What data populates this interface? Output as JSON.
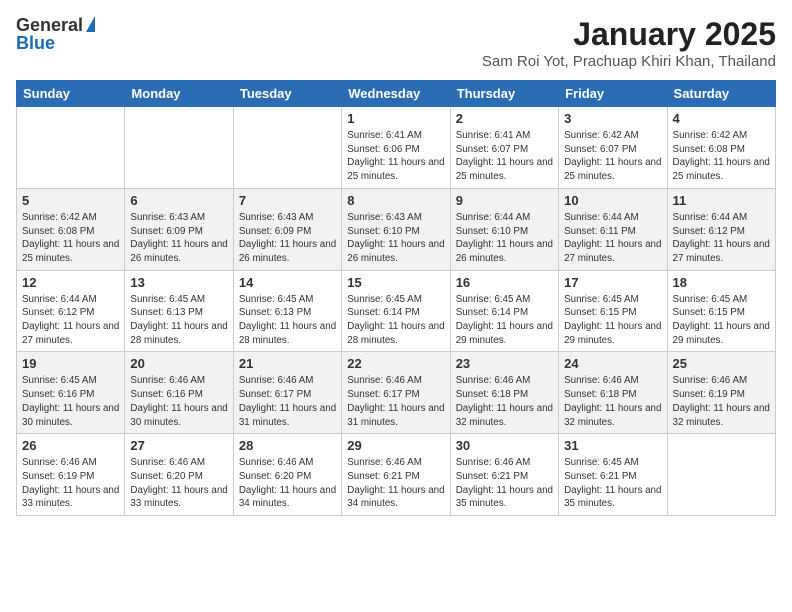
{
  "logo": {
    "general": "General",
    "blue": "Blue"
  },
  "title": "January 2025",
  "subtitle": "Sam Roi Yot, Prachuap Khiri Khan, Thailand",
  "days_of_week": [
    "Sunday",
    "Monday",
    "Tuesday",
    "Wednesday",
    "Thursday",
    "Friday",
    "Saturday"
  ],
  "weeks": [
    [
      {
        "day": "",
        "sunrise": "",
        "sunset": "",
        "daylight": ""
      },
      {
        "day": "",
        "sunrise": "",
        "sunset": "",
        "daylight": ""
      },
      {
        "day": "",
        "sunrise": "",
        "sunset": "",
        "daylight": ""
      },
      {
        "day": "1",
        "sunrise": "Sunrise: 6:41 AM",
        "sunset": "Sunset: 6:06 PM",
        "daylight": "Daylight: 11 hours and 25 minutes."
      },
      {
        "day": "2",
        "sunrise": "Sunrise: 6:41 AM",
        "sunset": "Sunset: 6:07 PM",
        "daylight": "Daylight: 11 hours and 25 minutes."
      },
      {
        "day": "3",
        "sunrise": "Sunrise: 6:42 AM",
        "sunset": "Sunset: 6:07 PM",
        "daylight": "Daylight: 11 hours and 25 minutes."
      },
      {
        "day": "4",
        "sunrise": "Sunrise: 6:42 AM",
        "sunset": "Sunset: 6:08 PM",
        "daylight": "Daylight: 11 hours and 25 minutes."
      }
    ],
    [
      {
        "day": "5",
        "sunrise": "Sunrise: 6:42 AM",
        "sunset": "Sunset: 6:08 PM",
        "daylight": "Daylight: 11 hours and 25 minutes."
      },
      {
        "day": "6",
        "sunrise": "Sunrise: 6:43 AM",
        "sunset": "Sunset: 6:09 PM",
        "daylight": "Daylight: 11 hours and 26 minutes."
      },
      {
        "day": "7",
        "sunrise": "Sunrise: 6:43 AM",
        "sunset": "Sunset: 6:09 PM",
        "daylight": "Daylight: 11 hours and 26 minutes."
      },
      {
        "day": "8",
        "sunrise": "Sunrise: 6:43 AM",
        "sunset": "Sunset: 6:10 PM",
        "daylight": "Daylight: 11 hours and 26 minutes."
      },
      {
        "day": "9",
        "sunrise": "Sunrise: 6:44 AM",
        "sunset": "Sunset: 6:10 PM",
        "daylight": "Daylight: 11 hours and 26 minutes."
      },
      {
        "day": "10",
        "sunrise": "Sunrise: 6:44 AM",
        "sunset": "Sunset: 6:11 PM",
        "daylight": "Daylight: 11 hours and 27 minutes."
      },
      {
        "day": "11",
        "sunrise": "Sunrise: 6:44 AM",
        "sunset": "Sunset: 6:12 PM",
        "daylight": "Daylight: 11 hours and 27 minutes."
      }
    ],
    [
      {
        "day": "12",
        "sunrise": "Sunrise: 6:44 AM",
        "sunset": "Sunset: 6:12 PM",
        "daylight": "Daylight: 11 hours and 27 minutes."
      },
      {
        "day": "13",
        "sunrise": "Sunrise: 6:45 AM",
        "sunset": "Sunset: 6:13 PM",
        "daylight": "Daylight: 11 hours and 28 minutes."
      },
      {
        "day": "14",
        "sunrise": "Sunrise: 6:45 AM",
        "sunset": "Sunset: 6:13 PM",
        "daylight": "Daylight: 11 hours and 28 minutes."
      },
      {
        "day": "15",
        "sunrise": "Sunrise: 6:45 AM",
        "sunset": "Sunset: 6:14 PM",
        "daylight": "Daylight: 11 hours and 28 minutes."
      },
      {
        "day": "16",
        "sunrise": "Sunrise: 6:45 AM",
        "sunset": "Sunset: 6:14 PM",
        "daylight": "Daylight: 11 hours and 29 minutes."
      },
      {
        "day": "17",
        "sunrise": "Sunrise: 6:45 AM",
        "sunset": "Sunset: 6:15 PM",
        "daylight": "Daylight: 11 hours and 29 minutes."
      },
      {
        "day": "18",
        "sunrise": "Sunrise: 6:45 AM",
        "sunset": "Sunset: 6:15 PM",
        "daylight": "Daylight: 11 hours and 29 minutes."
      }
    ],
    [
      {
        "day": "19",
        "sunrise": "Sunrise: 6:45 AM",
        "sunset": "Sunset: 6:16 PM",
        "daylight": "Daylight: 11 hours and 30 minutes."
      },
      {
        "day": "20",
        "sunrise": "Sunrise: 6:46 AM",
        "sunset": "Sunset: 6:16 PM",
        "daylight": "Daylight: 11 hours and 30 minutes."
      },
      {
        "day": "21",
        "sunrise": "Sunrise: 6:46 AM",
        "sunset": "Sunset: 6:17 PM",
        "daylight": "Daylight: 11 hours and 31 minutes."
      },
      {
        "day": "22",
        "sunrise": "Sunrise: 6:46 AM",
        "sunset": "Sunset: 6:17 PM",
        "daylight": "Daylight: 11 hours and 31 minutes."
      },
      {
        "day": "23",
        "sunrise": "Sunrise: 6:46 AM",
        "sunset": "Sunset: 6:18 PM",
        "daylight": "Daylight: 11 hours and 32 minutes."
      },
      {
        "day": "24",
        "sunrise": "Sunrise: 6:46 AM",
        "sunset": "Sunset: 6:18 PM",
        "daylight": "Daylight: 11 hours and 32 minutes."
      },
      {
        "day": "25",
        "sunrise": "Sunrise: 6:46 AM",
        "sunset": "Sunset: 6:19 PM",
        "daylight": "Daylight: 11 hours and 32 minutes."
      }
    ],
    [
      {
        "day": "26",
        "sunrise": "Sunrise: 6:46 AM",
        "sunset": "Sunset: 6:19 PM",
        "daylight": "Daylight: 11 hours and 33 minutes."
      },
      {
        "day": "27",
        "sunrise": "Sunrise: 6:46 AM",
        "sunset": "Sunset: 6:20 PM",
        "daylight": "Daylight: 11 hours and 33 minutes."
      },
      {
        "day": "28",
        "sunrise": "Sunrise: 6:46 AM",
        "sunset": "Sunset: 6:20 PM",
        "daylight": "Daylight: 11 hours and 34 minutes."
      },
      {
        "day": "29",
        "sunrise": "Sunrise: 6:46 AM",
        "sunset": "Sunset: 6:21 PM",
        "daylight": "Daylight: 11 hours and 34 minutes."
      },
      {
        "day": "30",
        "sunrise": "Sunrise: 6:46 AM",
        "sunset": "Sunset: 6:21 PM",
        "daylight": "Daylight: 11 hours and 35 minutes."
      },
      {
        "day": "31",
        "sunrise": "Sunrise: 6:45 AM",
        "sunset": "Sunset: 6:21 PM",
        "daylight": "Daylight: 11 hours and 35 minutes."
      },
      {
        "day": "",
        "sunrise": "",
        "sunset": "",
        "daylight": ""
      }
    ]
  ]
}
